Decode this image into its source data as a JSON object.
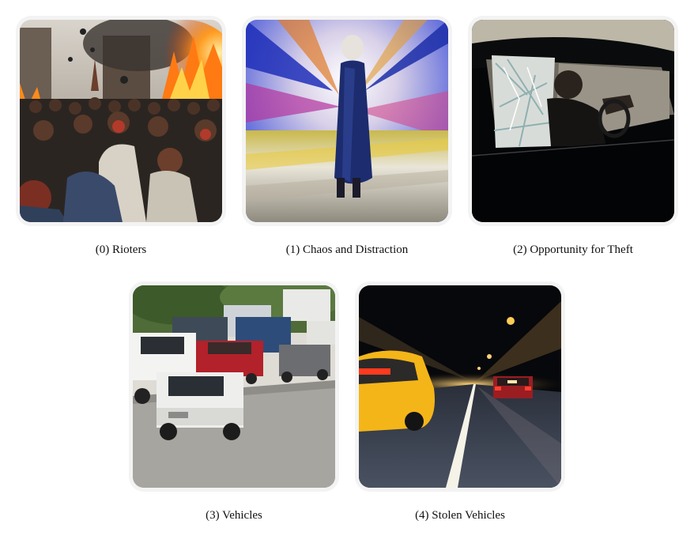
{
  "panels": [
    {
      "index": "0",
      "label": "(0) Rioters"
    },
    {
      "index": "1",
      "label": "(1) Chaos and Distraction"
    },
    {
      "index": "2",
      "label": "(2) Opportunity for Theft"
    },
    {
      "index": "3",
      "label": "(3) Vehicles"
    },
    {
      "index": "4",
      "label": "(4) Stolen Vehicles"
    }
  ]
}
